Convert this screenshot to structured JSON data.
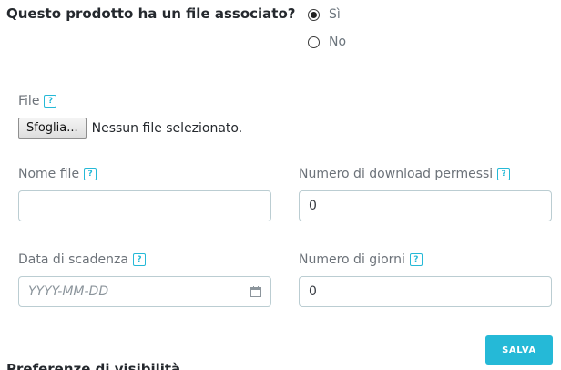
{
  "question": {
    "text": "Questo prodotto ha un file associato?",
    "options": [
      {
        "label": "Sì",
        "selected": true
      },
      {
        "label": "No",
        "selected": false
      }
    ]
  },
  "file": {
    "label": "File",
    "browse_label": "Sfoglia...",
    "status": "Nessun file selezionato."
  },
  "file_name": {
    "label": "Nome file",
    "value": ""
  },
  "downloads": {
    "label": "Numero di download permessi",
    "value": "0"
  },
  "expiry": {
    "label": "Data di scadenza",
    "placeholder": "YYYY-MM-DD"
  },
  "days": {
    "label": "Numero di giorni",
    "value": "0"
  },
  "help_glyph": "?",
  "save_label": "SALVA",
  "next_heading": "Preferenze di visibilità",
  "colors": {
    "accent": "#25b9d7",
    "input_border": "#bbcdd2"
  }
}
